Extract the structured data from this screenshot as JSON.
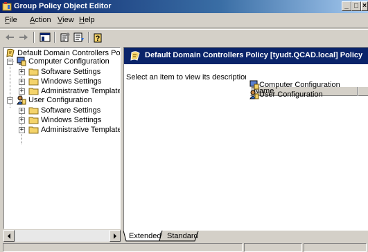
{
  "window": {
    "title": "Group Policy Object Editor",
    "controls": {
      "minimize": "_",
      "maximize": "□",
      "close": "×"
    }
  },
  "menu": [
    {
      "pre": "",
      "u": "F",
      "post": "ile"
    },
    {
      "pre": "",
      "u": "A",
      "post": "ction"
    },
    {
      "pre": "",
      "u": "V",
      "post": "iew"
    },
    {
      "pre": "",
      "u": "H",
      "post": "elp"
    }
  ],
  "tree": {
    "root": "Default Domain Controllers Policy [t",
    "computer": "Computer Configuration",
    "computer_children": [
      "Software Settings",
      "Windows Settings",
      "Administrative Templates"
    ],
    "user": "User Configuration",
    "user_children": [
      "Software Settings",
      "Windows Settings",
      "Administrative Templates"
    ]
  },
  "details": {
    "banner": "Default Domain Controllers Policy [tyudt.QCAD.local] Policy",
    "description": "Select an item to view its description.",
    "column_name": "Name",
    "items": [
      "Computer Configuration",
      "User Configuration"
    ]
  },
  "tabs": [
    "Extended",
    "Standard"
  ],
  "colors": {
    "title_start": "#0a246a",
    "title_end": "#a6caf0",
    "banner": "#0a246a",
    "face": "#d4d0c8",
    "folder": "#f4d36a"
  }
}
